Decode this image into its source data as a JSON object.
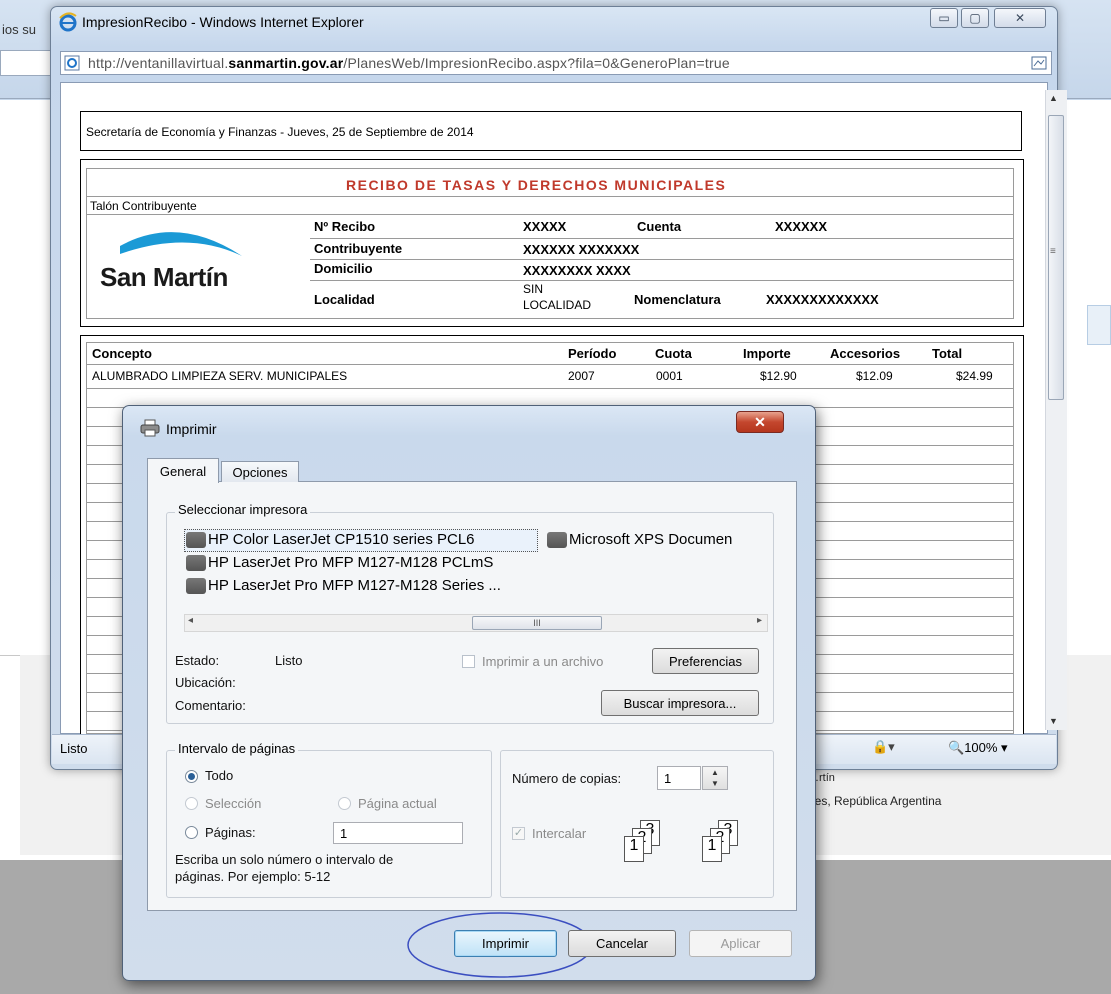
{
  "background": {
    "tab_text": "ios su",
    "footer_line1": "…rtín",
    "footer_line2": "ires, República Argentina"
  },
  "ie_window": {
    "title": "ImpresionRecibo - Windows Internet Explorer",
    "url_prefix": "http://ventanillavirtual.",
    "url_domain": "sanmartin.gov.ar",
    "url_path": "/PlanesWeb/ImpresionRecibo.aspx?fila=0&GeneroPlan=true",
    "status": "Listo",
    "zoom": "100%"
  },
  "receipt": {
    "header": "Secretaría de Economía y Finanzas - Jueves, 25 de Septiembre de 2014",
    "title": "RECIBO DE TASAS Y DERECHOS MUNICIPALES",
    "talon": "Talón Contribuyente",
    "logo_text": "San Martín",
    "recibo_label": "Nº Recibo",
    "recibo_value": "XXXXX",
    "cuenta_label": "Cuenta",
    "cuenta_value": "XXXXXX",
    "contribuyente_label": "Contribuyente",
    "contribuyente_value": "XXXXXX XXXXXXX",
    "domicilio_label": "Domicilio",
    "domicilio_value": "XXXXXXXX XXXX",
    "localidad_label": "Localidad",
    "localidad_value_1": "SIN",
    "localidad_value_2": "LOCALIDAD",
    "nomenclatura_label": "Nomenclatura",
    "nomenclatura_value": "XXXXXXXXXXXXX",
    "table_headers": {
      "concepto": "Concepto",
      "periodo": "Período",
      "cuota": "Cuota",
      "importe": "Importe",
      "accesorios": "Accesorios",
      "total": "Total"
    },
    "rows": [
      {
        "concepto": "ALUMBRADO LIMPIEZA SERV. MUNICIPALES",
        "periodo": "2007",
        "cuota": "0001",
        "importe": "$12.90",
        "accesorios": "$12.09",
        "total": "$24.99"
      }
    ]
  },
  "print_dialog": {
    "title": "Imprimir",
    "tabs": [
      "General",
      "Opciones"
    ],
    "select_printer_legend": "Seleccionar impresora",
    "printers": [
      "HP Color LaserJet CP1510 series PCL6",
      "HP LaserJet Pro MFP M127-M128 PCLmS",
      "HP LaserJet Pro MFP M127-M128 Series ...",
      "Microsoft XPS Documen"
    ],
    "scroll_grip": "III",
    "estado_label": "Estado:",
    "estado_value": "Listo",
    "ubicacion_label": "Ubicación:",
    "comentario_label": "Comentario:",
    "print_to_file": "Imprimir a un archivo",
    "preferences": "Preferencias",
    "find_printer": "Buscar impresora...",
    "range_legend": "Intervalo de páginas",
    "range_all": "Todo",
    "range_selection": "Selección",
    "range_current": "Página actual",
    "range_pages": "Páginas:",
    "pages_value": "1",
    "range_hint_1": "Escriba un solo número o intervalo de",
    "range_hint_2": "páginas. Por ejemplo: 5-12",
    "copies_label": "Número de copias:",
    "copies_value": "1",
    "collate": "Intercalar",
    "collate_numbers": [
      "1",
      "2",
      "3"
    ],
    "print_button": "Imprimir",
    "cancel_button": "Cancelar",
    "apply_button": "Aplicar"
  }
}
